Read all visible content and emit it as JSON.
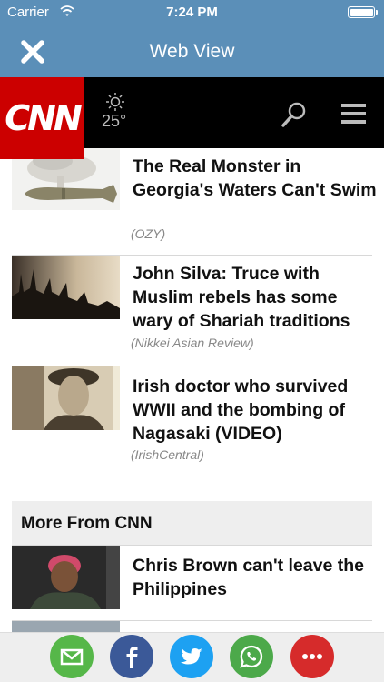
{
  "status_bar": {
    "carrier": "Carrier",
    "time": "7:24 PM"
  },
  "nav_bar": {
    "title": "Web View",
    "close_icon": "close-icon"
  },
  "header": {
    "logo": "CNN",
    "weather_temp": "25°",
    "weather_icon": "sun-icon",
    "search_icon": "search-icon",
    "menu_icon": "hamburger-menu-icon"
  },
  "articles": [
    {
      "headline": "The Real Monster in Georgia's Waters Can't Swim",
      "source": "(OZY)"
    },
    {
      "headline": "John Silva: Truce with Muslim rebels has some wary of Shariah traditions",
      "source": "(Nikkei Asian Review)"
    },
    {
      "headline": "Irish doctor who survived WWII and the bombing of Nagasaki (VIDEO)",
      "source": "(IrishCentral)"
    }
  ],
  "more_section": {
    "title": "More From CNN",
    "articles": [
      {
        "headline": "Chris Brown can't leave the Philippines"
      }
    ]
  },
  "share": [
    {
      "icon": "email-icon",
      "color": "#56b749"
    },
    {
      "icon": "facebook-icon",
      "color": "#3b5998"
    },
    {
      "icon": "twitter-icon",
      "color": "#1da1f2"
    },
    {
      "icon": "whatsapp-icon",
      "color": "#4ca94a"
    },
    {
      "icon": "more-icon",
      "color": "#d62b2b"
    }
  ],
  "colors": {
    "nav": "#5b8fb8",
    "cnn_red": "#cc0000",
    "header_bg": "#000000"
  }
}
